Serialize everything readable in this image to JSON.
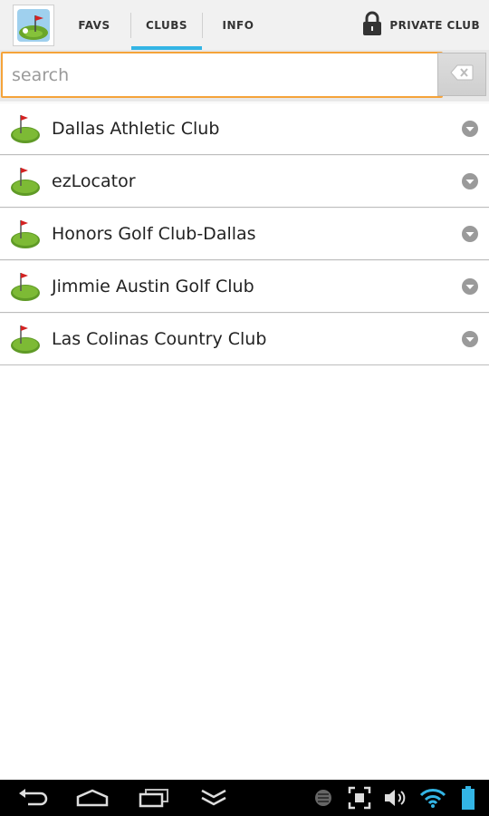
{
  "tabs": {
    "favs": "FAVS",
    "clubs": "CLUBS",
    "info": "INFO",
    "active": "CLUBS"
  },
  "private_club": {
    "label": "PRIVATE CLUB",
    "icon": "lock-icon"
  },
  "search": {
    "placeholder": "search",
    "value": "",
    "clear_icon": "backspace-icon"
  },
  "clubs": [
    {
      "name": "Dallas Athletic Club"
    },
    {
      "name": "ezLocator"
    },
    {
      "name": "Honors Golf Club-Dallas"
    },
    {
      "name": "Jimmie Austin Golf Club"
    },
    {
      "name": "Las Colinas Country Club"
    }
  ],
  "icons": {
    "app": "golf-app-icon",
    "list_item": "golf-flag-icon",
    "expand": "chevron-down-icon"
  },
  "nav_bar": [
    "back-icon",
    "home-icon",
    "recent-apps-icon",
    "menu-icon",
    "usb-debug-icon",
    "screenshot-icon",
    "volume-icon",
    "wifi-icon",
    "battery-icon"
  ],
  "colors": {
    "accent": "#33b5e5",
    "search_border": "#f5a33a",
    "green": "#6aa62a",
    "flag_red": "#d32222"
  }
}
